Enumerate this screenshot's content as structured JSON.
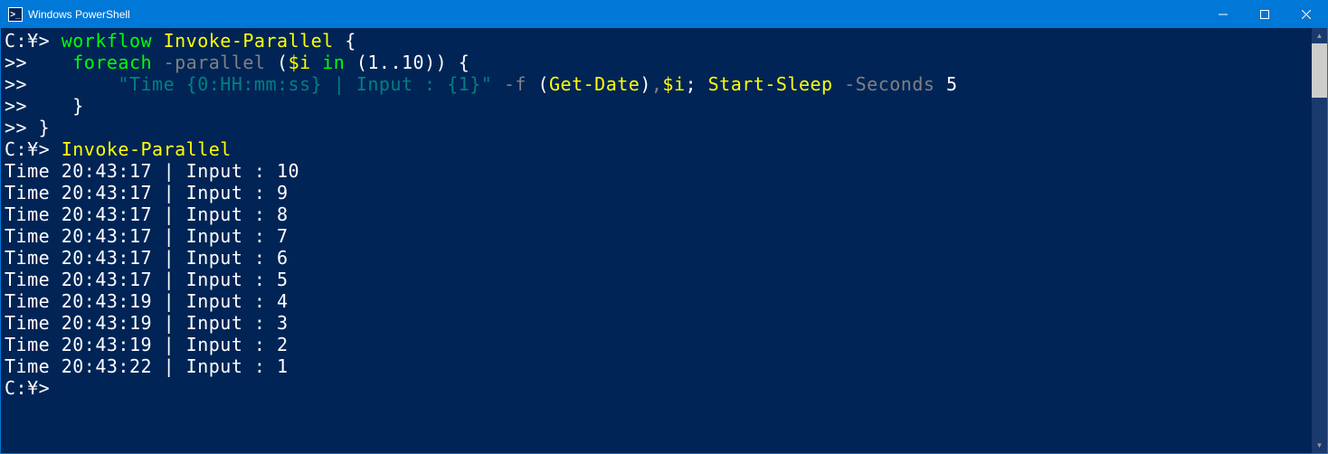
{
  "window": {
    "title": "Windows PowerShell",
    "icon_glyph": ">_"
  },
  "colors": {
    "titlebar": "#0078d7",
    "background": "#012456",
    "text": "#ffffff",
    "keyword": "#00ff00",
    "command": "#ffff00",
    "param": "#808080",
    "string": "#008080"
  },
  "prompts": {
    "main": "C:¥>",
    "cont": ">>"
  },
  "code": {
    "l1_kw": "workflow",
    "l1_cmd": "Invoke-Parallel",
    "l1_brace": " {",
    "l2_indent": "    ",
    "l2_kw": "foreach",
    "l2_param": " -parallel ",
    "l2_paren1": "(",
    "l2_var": "$i",
    "l2_in": " in ",
    "l2_paren2": "(",
    "l2_range1": "1",
    "l2_dots": "..",
    "l2_range2": "10",
    "l2_paren3": "))",
    "l2_brace": " {",
    "l3_indent": "        ",
    "l3_str": "\"Time {0:HH:mm:ss} | Input : {1}\"",
    "l3_f": " -f ",
    "l3_p1": "(",
    "l3_getdate": "Get-Date",
    "l3_p2": ")",
    "l3_comma": ",",
    "l3_var": "$i",
    "l3_semi": "; ",
    "l3_sleep": "Start-Sleep",
    "l3_sec": " -Seconds ",
    "l3_five": "5",
    "l4_indent": "    ",
    "l4_brace": "}",
    "l5_brace": "}",
    "invoke": "Invoke-Parallel"
  },
  "output": [
    "Time 20:43:17 | Input : 10",
    "Time 20:43:17 | Input : 9",
    "Time 20:43:17 | Input : 8",
    "Time 20:43:17 | Input : 7",
    "Time 20:43:17 | Input : 6",
    "Time 20:43:17 | Input : 5",
    "Time 20:43:19 | Input : 4",
    "Time 20:43:19 | Input : 3",
    "Time 20:43:19 | Input : 2",
    "Time 20:43:22 | Input : 1"
  ]
}
